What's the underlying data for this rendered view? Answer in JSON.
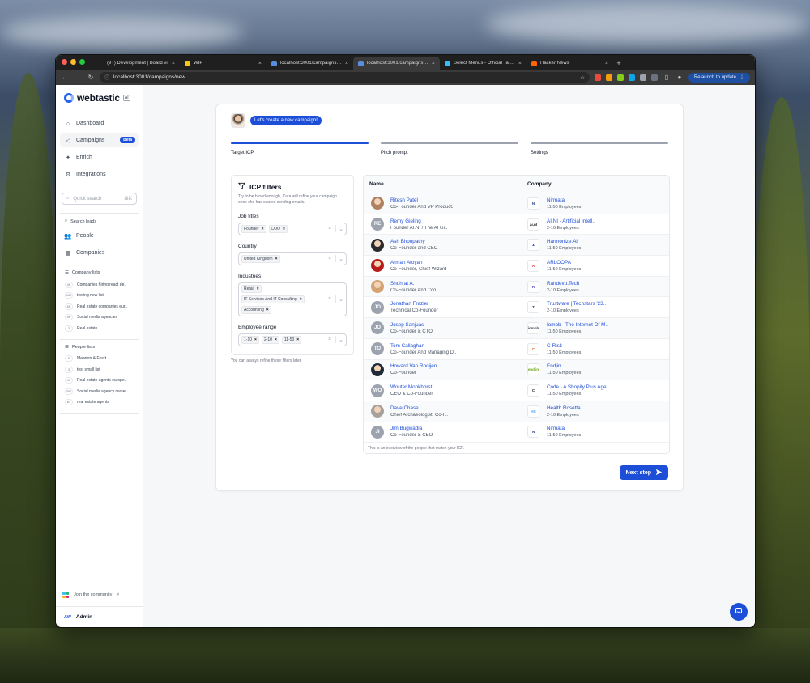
{
  "browser": {
    "tabs": [
      {
        "label": "(9+) Development | Board vi",
        "color": "#1f1f1f"
      },
      {
        "label": "WIP",
        "color": "#f5c518"
      },
      {
        "label": "localhost:3001/campaigns/ne",
        "color": "#5a8de0"
      },
      {
        "label": "localhost:3001/campaigns/ne",
        "color": "#5a8de0"
      },
      {
        "label": "Select Menus - Official Tailwi",
        "color": "#38bdf8"
      },
      {
        "label": "Hacker News",
        "color": "#ff6600"
      }
    ],
    "active_tab": 3,
    "url": "localhost:3001/campaigns/new",
    "relaunch_label": "Relaunch to update"
  },
  "sidebar": {
    "brand": "webtastic",
    "brand_badge": "AI",
    "nav": [
      {
        "label": "Dashboard",
        "icon": "home-icon"
      },
      {
        "label": "Campaigns",
        "icon": "megaphone-icon",
        "badge": "Beta"
      },
      {
        "label": "Enrich",
        "icon": "sparkle-icon"
      },
      {
        "label": "Integrations",
        "icon": "puzzle-icon"
      }
    ],
    "search_placeholder": "Quick search",
    "search_shortcut": "⌘K",
    "search_leads_title": "Search leads",
    "search_leads": [
      {
        "label": "People",
        "icon": "users-icon"
      },
      {
        "label": "Companies",
        "icon": "building-icon"
      }
    ],
    "company_lists_title": "Company lists",
    "company_lists": [
      {
        "count": "4K",
        "label": "Companies hiring react de.."
      },
      {
        "count": "100",
        "label": "testing new list"
      },
      {
        "count": "5K",
        "label": "Real estate companies eur.."
      },
      {
        "count": "4K",
        "label": "Social media agencies"
      },
      {
        "count": "3",
        "label": "Real estate"
      }
    ],
    "people_lists_title": "People lists",
    "people_lists": [
      {
        "count": "2",
        "label": "Maarten & Evert"
      },
      {
        "count": "3",
        "label": "test small list"
      },
      {
        "count": "4K",
        "label": "Real estate agents europe.."
      },
      {
        "count": "300",
        "label": "Social media agency owner.."
      },
      {
        "count": "63",
        "label": "real estate agents"
      }
    ],
    "community_label": "Join the community",
    "user_initials": "AW",
    "user_name": "Admin"
  },
  "campaign": {
    "greeting": "Let's create a new campaign!",
    "steps": [
      {
        "label": "Target ICP",
        "active": true
      },
      {
        "label": "Pitch prompt",
        "active": false
      },
      {
        "label": "Settings",
        "active": false
      }
    ]
  },
  "filters": {
    "title": "ICP filters",
    "description": "Try to be broad enough, Cara will refine your campaign once she has started sending emails.",
    "groups": [
      {
        "label": "Job titles",
        "chips": [
          "Founder",
          "COO"
        ]
      },
      {
        "label": "Country",
        "chips": [
          "United Kingdom"
        ]
      },
      {
        "label": "Industries",
        "chips": [
          "Retail",
          "IT Services And IT Consulting",
          "Accounting"
        ]
      },
      {
        "label": "Employee range",
        "chips": [
          "1-10",
          "2-10",
          "11-50"
        ]
      }
    ],
    "note": "You can always refine these filters later."
  },
  "table": {
    "headers": [
      "Name",
      "Company"
    ],
    "rows": [
      {
        "name": "Ritesh Patel",
        "title": "Co-Founder And VP Product..",
        "avatar": "photo",
        "avatar_color": "#b08060",
        "company": "Nirmata",
        "size": "11-50 Employees",
        "logo_text": "N",
        "logo_color": "#1e3a8a"
      },
      {
        "name": "Remy Gieling",
        "title": "Founder AI.NI / The AI Gr..",
        "avatar": "RE",
        "avatar_color": "#9ca3af",
        "company": "AI.NI - Artificial Intell..",
        "size": "2-10 Employees",
        "logo_text": "ai.nl",
        "logo_color": "#111111"
      },
      {
        "name": "Ash Bhoopathy",
        "title": "Co-Founder and CEO",
        "avatar": "photo",
        "avatar_color": "#2b2b2b",
        "company": "Harmonize.Ai",
        "size": "11-50 Employees",
        "logo_text": "▲",
        "logo_color": "#2563eb"
      },
      {
        "name": "Arman Atoyan",
        "title": "Co-Founder, Chief Wizard",
        "avatar": "photo",
        "avatar_color": "#b91c1c",
        "company": "ARLOOPA",
        "size": "11-50 Employees",
        "logo_text": "A",
        "logo_color": "#dc2626"
      },
      {
        "name": "Shuhrat A.",
        "title": "Co-Founder And Cco",
        "avatar": "photo",
        "avatar_color": "#d4a373",
        "company": "Randevu.Tech",
        "size": "2-10 Employees",
        "logo_text": "R",
        "logo_color": "#4338ca"
      },
      {
        "name": "Jonathan Frazier",
        "title": "Technical Co-Founder",
        "avatar": "JO",
        "avatar_color": "#9ca3af",
        "company": "Trustware | Techstars '23..",
        "size": "2-10 Employees",
        "logo_text": "T",
        "logo_color": "#1e3a8a"
      },
      {
        "name": "Josep Sanjuas",
        "title": "Co-Founder & CTO",
        "avatar": "JO",
        "avatar_color": "#9ca3af",
        "company": "Iomob - The Internet Of M..",
        "size": "11-50 Employees",
        "logo_text": "iomob",
        "logo_color": "#374151"
      },
      {
        "name": "Tom Callaghan",
        "title": "Co-Founder And Managing D..",
        "avatar": "TO",
        "avatar_color": "#9ca3af",
        "company": "C-Risk",
        "size": "11-50 Employees",
        "logo_text": "C",
        "logo_color": "#ea580c"
      },
      {
        "name": "Howard Van Rooijen",
        "title": "Co-Founder",
        "avatar": "photo",
        "avatar_color": "#1f2937",
        "company": "Endjin",
        "size": "11-50 Employees",
        "logo_text": "endjin",
        "logo_color": "#65a30d"
      },
      {
        "name": "Wouter Monkhorst",
        "title": "CEO & Co-Founder",
        "avatar": "WO",
        "avatar_color": "#9ca3af",
        "company": "Code - A Shopify Plus Age..",
        "size": "11-50 Employees",
        "logo_text": "C",
        "logo_color": "#111111"
      },
      {
        "name": "Dave Chase",
        "title": "Chief Archaeologist, Co-F..",
        "avatar": "photo",
        "avatar_color": "#a8a29e",
        "company": "Health Rosetta",
        "size": "2-10 Employees",
        "logo_text": "HR",
        "logo_color": "#60a5fa"
      },
      {
        "name": "Jim Bugwadia",
        "title": "Co-Founder & CEO",
        "avatar": "JI",
        "avatar_color": "#9ca3af",
        "company": "Nirmata",
        "size": "11-50 Employees",
        "logo_text": "N",
        "logo_color": "#1e3a8a"
      }
    ],
    "note": "This is an overview of the people that match your ICP."
  },
  "next_button": "Next step"
}
